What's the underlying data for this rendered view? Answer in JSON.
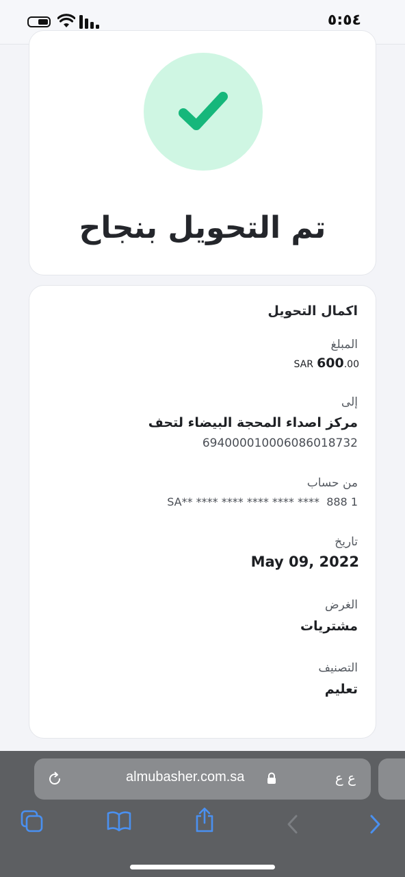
{
  "status_bar": {
    "time": "٥:٥٤"
  },
  "success_card": {
    "title": "تم التحويل بنجاح",
    "icon": "check-icon",
    "accent_color": "#16b77b",
    "circle_color": "#cff6e3"
  },
  "details": {
    "heading": "اكمال التحويل",
    "amount": {
      "label": "المبلغ",
      "currency": "SAR",
      "integer": "600",
      "decimals": ".00"
    },
    "to": {
      "label": "إلى",
      "name": "مركز اصداء المحجة البيضاء لتحف",
      "account": "694000010006086018732"
    },
    "from_account": {
      "label": "من حساب",
      "masked": "SA** **** **** **** **** ****  888 1"
    },
    "date": {
      "label": "تاريخ",
      "value": "May 09, 2022"
    },
    "purpose": {
      "label": "الغرض",
      "value": "مشتريات"
    },
    "category": {
      "label": "التصنيف",
      "value": "تعليم"
    }
  },
  "browser": {
    "url": "almubasher.com.sa",
    "text_size_label": "ع ع",
    "tint_color": "#4a90f0"
  }
}
